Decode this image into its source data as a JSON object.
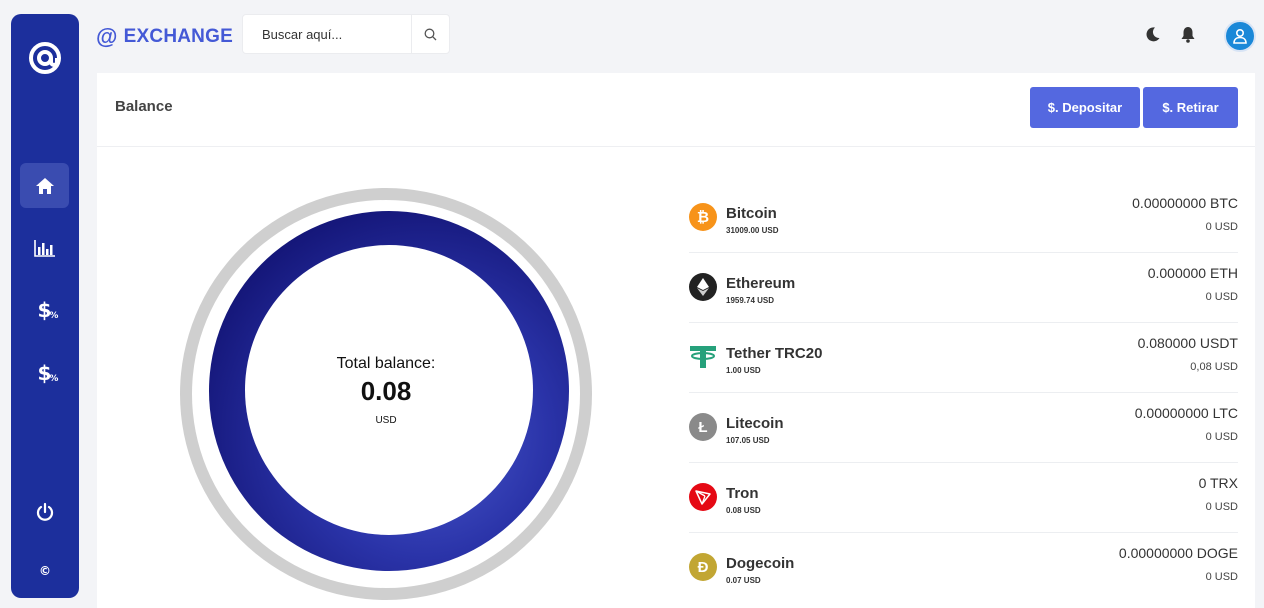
{
  "sidebar": {
    "logo": "@",
    "items": [
      {
        "name": "home",
        "icon": "home-icon",
        "active": true
      },
      {
        "name": "stats",
        "icon": "bar-chart-icon",
        "active": false
      },
      {
        "name": "deposit",
        "icon": "dollar-percent-icon",
        "glyph": "$",
        "active": false
      },
      {
        "name": "withdraw",
        "icon": "dollar-percent-icon",
        "glyph": "$",
        "active": false
      }
    ],
    "logout_icon": "power-icon",
    "copyright": "©"
  },
  "header": {
    "brand_symbol": "@",
    "brand_name": "EXCHANGE",
    "search_placeholder": "Buscar aquí...",
    "search_icon": "search-icon",
    "theme_icon": "moon-icon",
    "notifications_icon": "bell-icon",
    "avatar_icon": "user-icon"
  },
  "balance_card": {
    "title": "Balance",
    "deposit_button": "$. Depositar",
    "withdraw_button": "$. Retirar",
    "total_label": "Total balance:",
    "total_value": "0.08",
    "total_unit": "USD"
  },
  "colors": {
    "sidebar": "#1c2f9c",
    "brand": "#4459d6",
    "button": "#5468e0",
    "bitcoin": "#f7931a",
    "ethereum": "#222222",
    "tether": "#26a17b",
    "litecoin": "#8a8a8a",
    "tron": "#e50914",
    "dogecoin": "#c2a633"
  },
  "coins": [
    {
      "name": "Bitcoin",
      "price": "31009.00 USD",
      "amount": "0.00000000 BTC",
      "usd": "0 USD",
      "icon": "bitcoin-icon",
      "glyph": "₿",
      "color": "#f7931a"
    },
    {
      "name": "Ethereum",
      "price": "1959.74 USD",
      "amount": "0.000000 ETH",
      "usd": "0 USD",
      "icon": "ethereum-icon",
      "glyph": "◆",
      "color": "#222222"
    },
    {
      "name": "Tether TRC20",
      "price": "1.00 USD",
      "amount": "0.080000 USDT",
      "usd": "0,08 USD",
      "icon": "tether-icon",
      "glyph": "T",
      "color": "#26a17b"
    },
    {
      "name": "Litecoin",
      "price": "107.05 USD",
      "amount": "0.00000000 LTC",
      "usd": "0 USD",
      "icon": "litecoin-icon",
      "glyph": "Ł",
      "color": "#8a8a8a"
    },
    {
      "name": "Tron",
      "price": "0.08 USD",
      "amount": "0 TRX",
      "usd": "0 USD",
      "icon": "tron-icon",
      "glyph": "▽",
      "color": "#e50914"
    },
    {
      "name": "Dogecoin",
      "price": "0.07 USD",
      "amount": "0.00000000 DOGE",
      "usd": "0 USD",
      "icon": "dogecoin-icon",
      "glyph": "Ð",
      "color": "#c2a633"
    }
  ]
}
